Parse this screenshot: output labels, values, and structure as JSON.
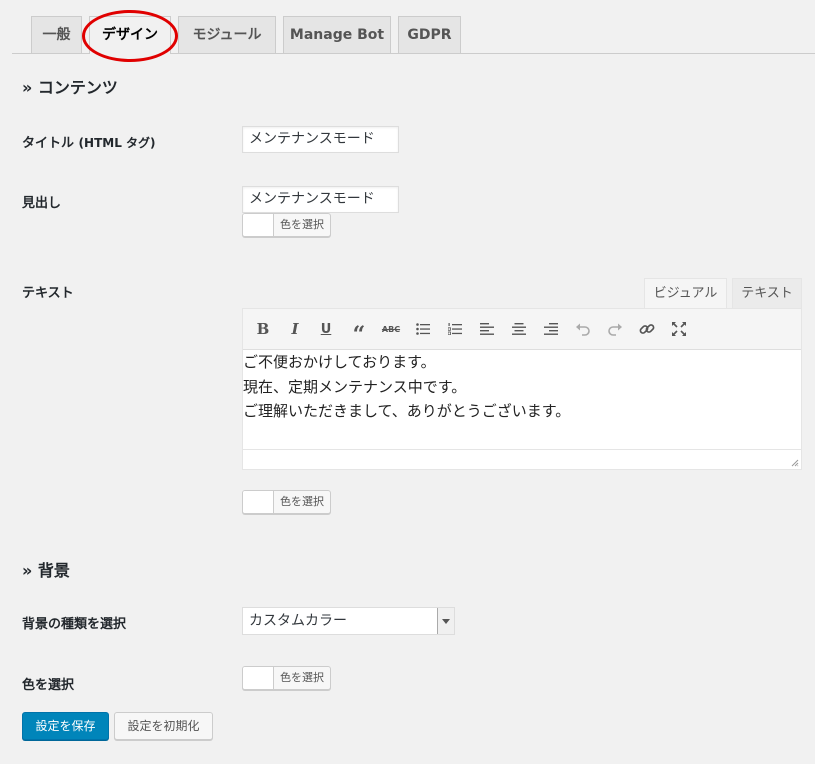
{
  "tabs": [
    {
      "label": "一般"
    },
    {
      "label": "デザイン",
      "active": true
    },
    {
      "label": "モジュール"
    },
    {
      "label": "Manage Bot"
    },
    {
      "label": "GDPR"
    }
  ],
  "highlight_color": "#e00000",
  "content_section": {
    "title": "» コンテンツ",
    "title_label": "タイトル",
    "title_label_suffix": "(HTML タグ)",
    "title_value": "メンテナンスモード",
    "heading_label": "見出し",
    "heading_value": "メンテナンスモード",
    "heading_color_button": "色を選択",
    "text_label": "テキスト",
    "editor_tab_visual": "ビジュアル",
    "editor_tab_text": "テキスト",
    "toolbar": [
      "bold-icon",
      "italic-icon",
      "underline-icon",
      "blockquote-icon",
      "strikethrough-icon",
      "bullet-list-icon",
      "numbered-list-icon",
      "align-left-icon",
      "align-center-icon",
      "align-right-icon",
      "undo-icon",
      "redo-icon",
      "link-icon",
      "fullscreen-icon"
    ],
    "editor_lines": [
      "ご不便おかけしております。",
      "現在、定期メンテナンス中です。",
      "ご理解いただきまして、ありがとうございます。"
    ],
    "text_color_button": "色を選択"
  },
  "background_section": {
    "title": "» 背景",
    "type_label": "背景の種類を選択",
    "type_value": "カスタムカラー",
    "color_label": "色を選択",
    "color_button": "色を選択"
  },
  "buttons": {
    "save": "設定を保存",
    "reset": "設定を初期化"
  },
  "colors": {
    "primary": "#0085ba",
    "background": "#f1f1f1"
  }
}
